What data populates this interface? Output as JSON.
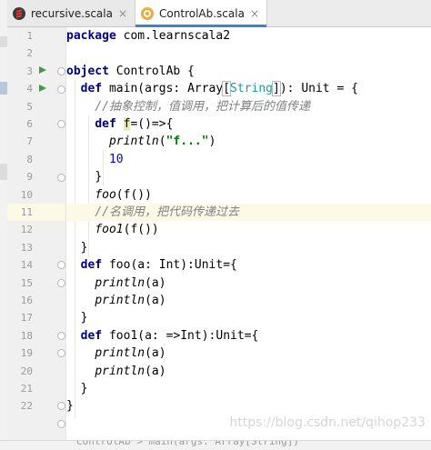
{
  "tabs": [
    {
      "label": "recursive.scala",
      "icon": "scala-file-icon",
      "active": false
    },
    {
      "label": "ControlAb.scala",
      "icon": "scala-object-icon",
      "active": true
    }
  ],
  "close_glyph": "×",
  "left_strip": {
    "label": "Pr"
  },
  "line_numbers": [
    "1",
    "2",
    "3",
    "4",
    "5",
    "6",
    "7",
    "8",
    "9",
    "10",
    "11",
    "12",
    "13",
    "14",
    "15",
    "16",
    "17",
    "18",
    "19",
    "20",
    "21",
    "22"
  ],
  "code": {
    "l1_pkg_kw": "package",
    "l1_pkg_name": " com.learnscala2",
    "l3_obj_kw": "object",
    "l3_obj_name": " ControlAb {",
    "l4_def_kw": "def",
    "l4_main_a": " main(args: ",
    "l4_array": "Array",
    "l4_br_open": "[",
    "l4_string": "String",
    "l4_br_close": "]",
    "l4_main_b": "): ",
    "l4_unit": "Unit",
    "l4_main_c": " = {",
    "l5_comment": "//抽象控制，值调用，把计算后的值传递",
    "l6_def_kw": "def",
    "l6_f": "f",
    "l6_rest": "=()=>{",
    "l7_println": "println",
    "l7_open": "(",
    "l7_str": "\"f...\"",
    "l7_close": ")",
    "l8_num": "10",
    "l9_brace": "}",
    "l10_foo": "foo",
    "l10_rest": "(f())",
    "l11_comment": "//名调用，把代码传递过去",
    "l12_foo1": "foo1",
    "l12_rest": "(f())",
    "l13_brace": "}",
    "l14_def_kw": "def",
    "l14_sig": " foo(a: Int):Unit={",
    "l15_println": "println",
    "l15_rest": "(a)",
    "l16_println": "println",
    "l16_rest": "(a)",
    "l17_brace": "}",
    "l18_def_kw": "def",
    "l18_sig": " foo1(a: =>Int):Unit={",
    "l19_println": "println",
    "l19_rest": "(a)",
    "l20_println": "println",
    "l20_rest": "(a)",
    "l21_brace": "}",
    "l22_brace": "}"
  },
  "current_line": 11,
  "watermark": "https://blog.csdn.net/qihop233",
  "bottom_crumb": "ControlAb > main(args: Array[String])",
  "colors": {
    "keyword": "#000080",
    "type": "#20999d",
    "string": "#008000",
    "number": "#0000ff",
    "comment": "#808080",
    "run": "#3f9a4c",
    "active_tab_underline": "#4083c9",
    "current_line_bg": "#fcfae7"
  }
}
